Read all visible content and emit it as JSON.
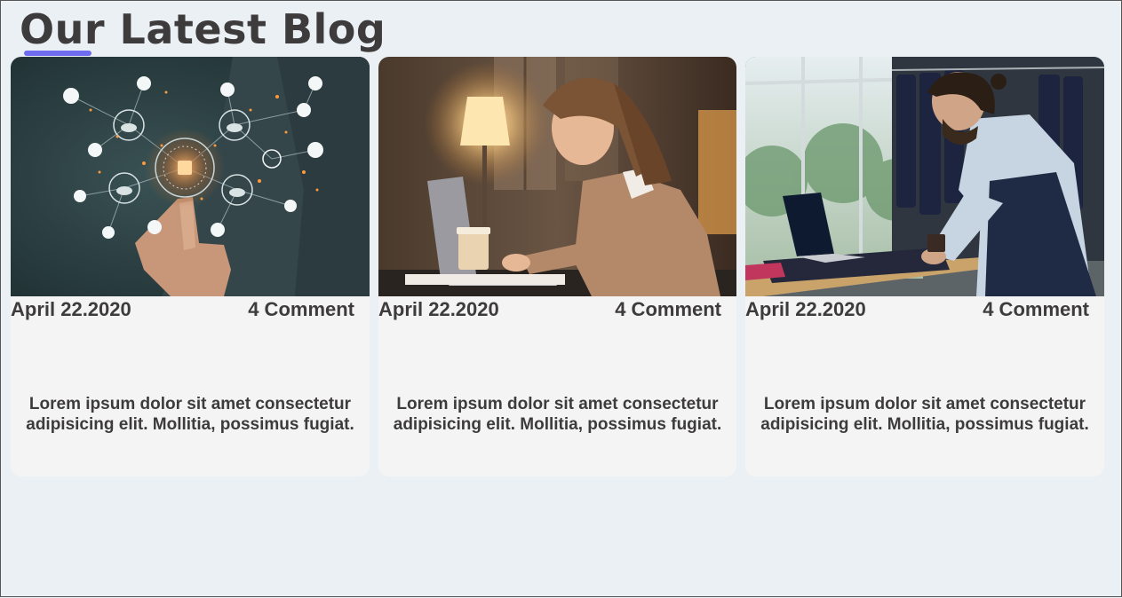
{
  "section": {
    "title": "Our Latest Blog",
    "accent_color": "#6f6cf0"
  },
  "posts": [
    {
      "image": "hand-touching-network-icons-image",
      "date": "April 22.2020",
      "comments": "4 Comment",
      "excerpt": "Lorem ipsum dolor sit amet consectetur adipisicing elit. Mollitia, possimus fugiat."
    },
    {
      "image": "woman-working-on-laptop-image",
      "date": "April 22.2020",
      "comments": "4 Comment",
      "excerpt": "Lorem ipsum dolor sit amet consectetur adipisicing elit. Mollitia, possimus fugiat."
    },
    {
      "image": "tailor-working-in-shop-image",
      "date": "April 22.2020",
      "comments": "4 Comment",
      "excerpt": "Lorem ipsum dolor sit amet consectetur adipisicing elit. Mollitia, possimus fugiat."
    }
  ]
}
